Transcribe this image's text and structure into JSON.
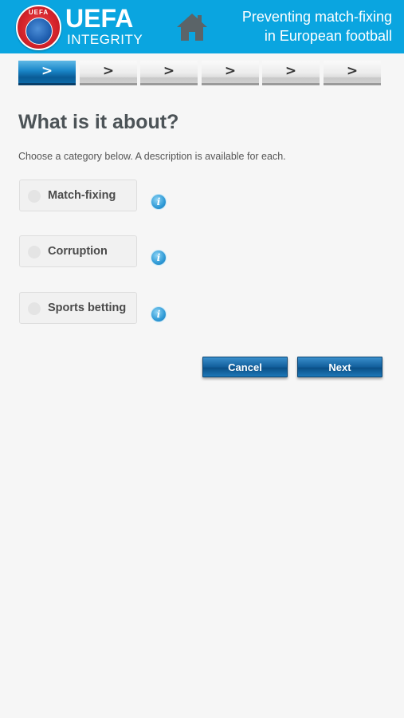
{
  "header": {
    "logo_ring": "UEFA",
    "brand_main": "UEFA",
    "brand_sub": "INTEGRITY",
    "tagline_line1": "Preventing match-fixing",
    "tagline_line2": "in European football",
    "home_icon": "home-icon",
    "bg_color": "#0aa5e0"
  },
  "steps": [
    ">",
    ">",
    ">",
    ">",
    ">",
    ">"
  ],
  "active_step": 1,
  "page": {
    "title": "What is it about?",
    "subtitle": "Choose a category below. A description is available for each."
  },
  "options": [
    {
      "label": "Match-fixing",
      "info_icon": "i"
    },
    {
      "label": "Corruption",
      "info_icon": "i"
    },
    {
      "label": "Sports betting",
      "info_icon": "i"
    }
  ],
  "buttons": {
    "cancel": "Cancel",
    "next": "Next"
  }
}
